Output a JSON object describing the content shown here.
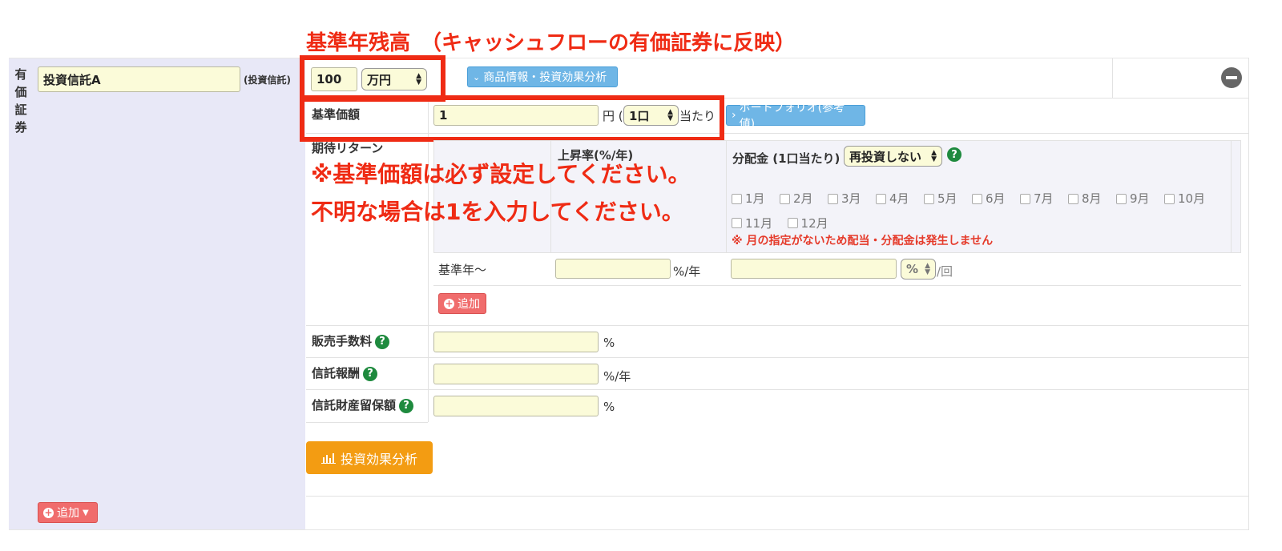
{
  "annotations": {
    "top": "基準年残高　（キャッシュフローの有価証券に反映）",
    "note1": "※基準価額は必ず設定してください。",
    "note2": "不明な場合は1を入力してください。"
  },
  "section": {
    "label": "有価証券",
    "chars": [
      "有",
      "価",
      "証",
      "券"
    ],
    "name_value": "投資信託A",
    "type_label": "(投資信託)"
  },
  "balance": {
    "value": "100",
    "unit": "万円"
  },
  "product_button": "商品情報・投資効果分析",
  "base_price": {
    "label": "基準価額",
    "value": "1",
    "unit_pre": "円 (",
    "per_select": "1口",
    "unit_post": "当たり"
  },
  "portfolio_button": "ポートフォリオ(参考値)",
  "expected_return": {
    "label": "期待リターン",
    "rise_header": "上昇率(%/年)",
    "dividend_header": "分配金 (1口当たり)",
    "reinvest_select": "再投資しない",
    "months": [
      "1月",
      "2月",
      "3月",
      "4月",
      "5月",
      "6月",
      "7月",
      "8月",
      "9月",
      "10月",
      "11月",
      "12月"
    ],
    "warning": "※ 月の指定がないため配当・分配金は発生しません",
    "base_year_label": "基準年〜",
    "rate_unit": "%/年",
    "pct_select": "%",
    "per_time": "/回",
    "add_button": "追加"
  },
  "fees": [
    {
      "label": "販売手数料",
      "unit": "%"
    },
    {
      "label": "信託報酬",
      "unit": "%/年"
    },
    {
      "label": "信託財産留保額",
      "unit": "%"
    }
  ],
  "analysis_button": "投資効果分析",
  "bottom_add_button": "追加",
  "colors": {
    "annotation": "#ef2b14",
    "input_bg": "#fbfbd9",
    "side_bg": "#e8e8f7",
    "orange": "#f39c12"
  }
}
